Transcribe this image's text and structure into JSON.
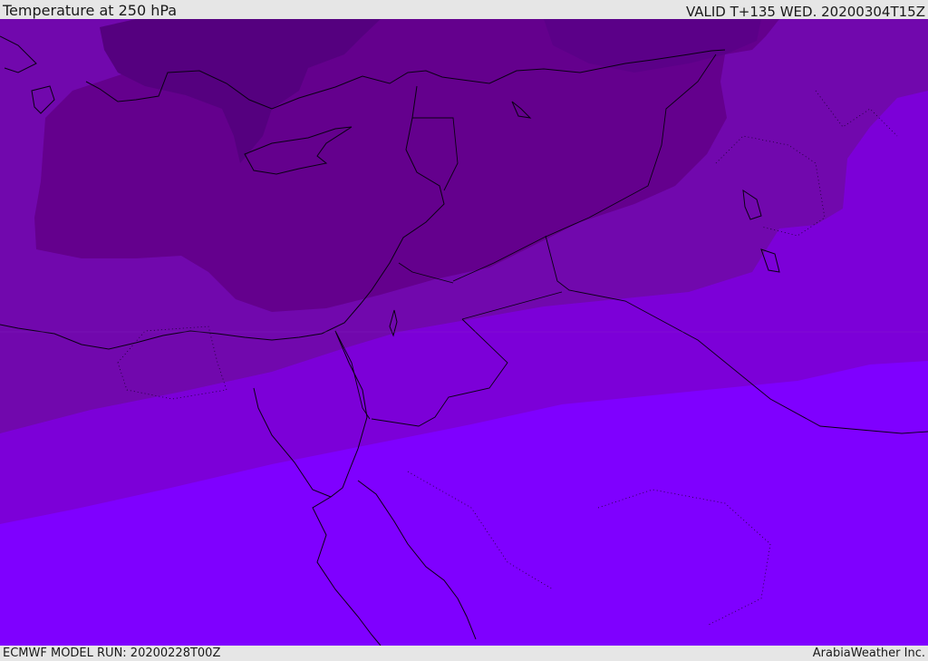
{
  "header": {
    "title": "Temperature at 250 hPa",
    "valid_time": "VALID T+135 WED. 20200304T15Z"
  },
  "footer": {
    "model_run": "ECMWF MODEL RUN: 20200228T00Z",
    "credit": "ArabiaWeather Inc."
  },
  "map": {
    "colors": {
      "band_darkest": "#55007f",
      "band_dark": "#64008d",
      "band_mid": "#7108ad",
      "band_light": "#7c00d8",
      "band_lightest": "#7f00ff",
      "coastline": "#0a0014"
    }
  }
}
